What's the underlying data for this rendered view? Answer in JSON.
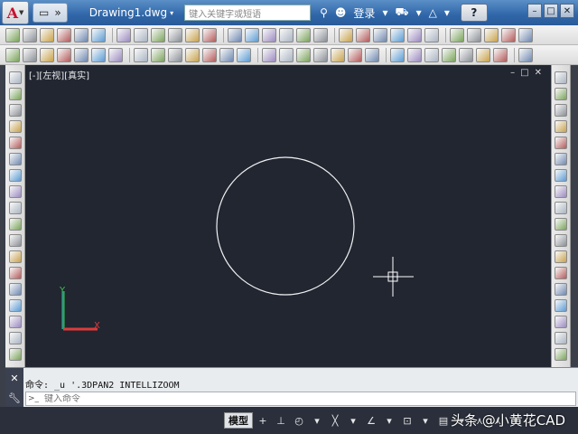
{
  "titlebar": {
    "app_logo": "A",
    "doc_title": "Drawing1.dwg",
    "search_placeholder": "键入关键字或短语",
    "login_label": "登录",
    "help_label": "?",
    "window_controls": [
      "–",
      "□",
      "✕"
    ]
  },
  "viewport": {
    "label": "[-][左视][真实]",
    "controls": [
      "–",
      "□",
      "✕"
    ]
  },
  "command": {
    "history": "命令: _u '.3DPAN2 INTELLIZOOM",
    "input_placeholder": "键入命令",
    "prompt_icon": ">_"
  },
  "statusbar": {
    "model_label": "模型",
    "items": [
      "+",
      "⊥",
      "◴",
      "▾",
      "╳",
      "▾",
      "∠",
      "▾",
      "⊡",
      "▾",
      "▤",
      "▾",
      "⋏",
      "⋏",
      "▾"
    ]
  },
  "watermark": "头条 @小黄花CAD",
  "colors": {
    "canvas": "#212631",
    "titlebar": "#2f66a8",
    "ucs_x": "#e03a3a",
    "ucs_y": "#3ac24a"
  }
}
